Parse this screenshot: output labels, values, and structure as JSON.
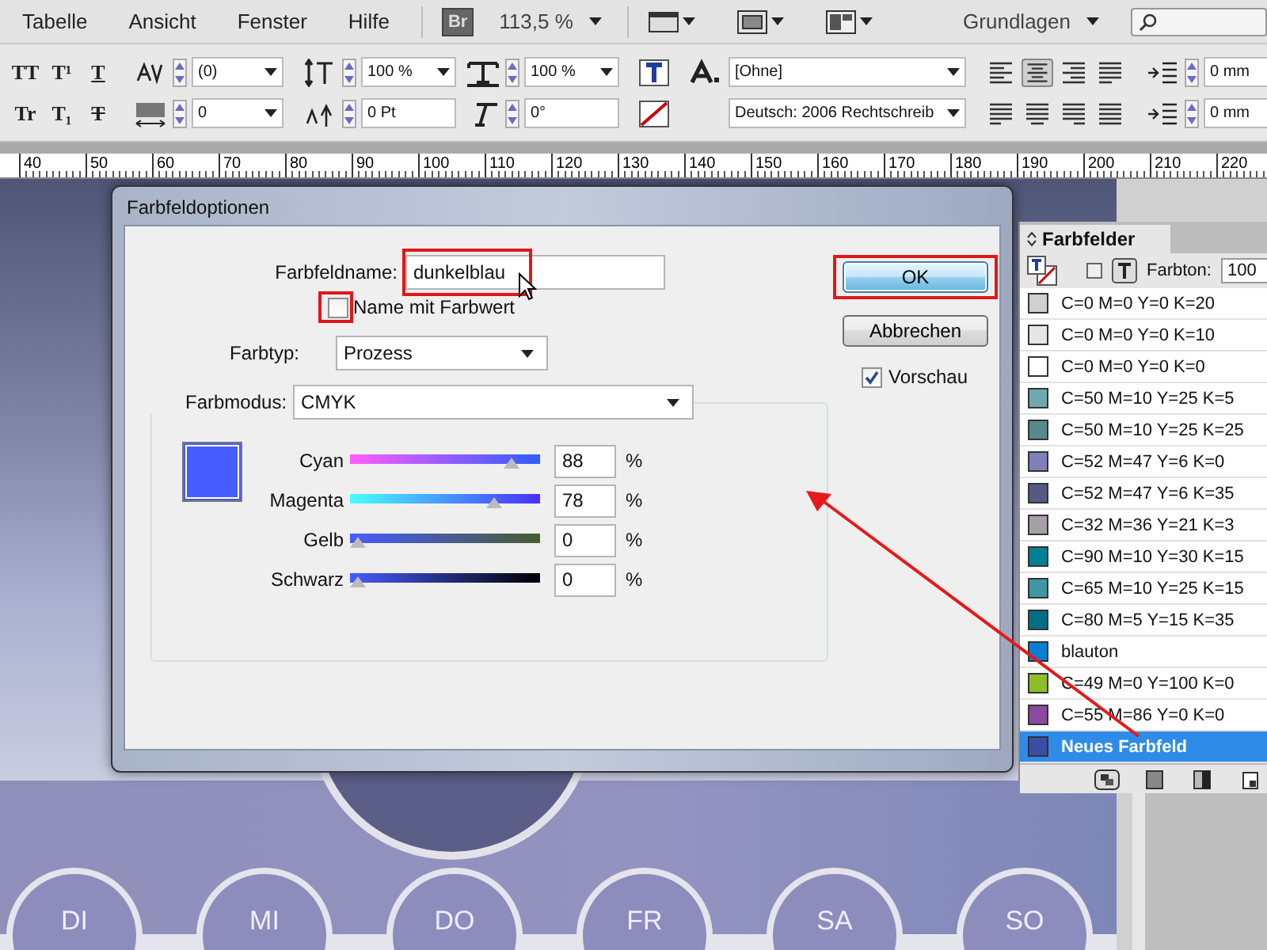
{
  "menu_bar": {
    "items": [
      "Tabelle",
      "Ansicht",
      "Fenster",
      "Hilfe"
    ],
    "bridge_button": "Br",
    "zoom": "113,5 %",
    "workspace": "Grundlagen"
  },
  "control_panel": {
    "text_style_buttons": [
      "TT",
      "T¹",
      "T",
      "Tr",
      "T₁",
      "T"
    ],
    "kerning": "(0)",
    "tracking": "0",
    "vertical_scale": "100 %",
    "baseline_shift": "0 Pt",
    "horizontal_scale": "100 %",
    "skew": "0°",
    "character_style": "[Ohne]",
    "language": "Deutsch: 2006 Rechtschreib",
    "indent_left": "0 mm",
    "indent_first": "0 mm"
  },
  "ruler": {
    "labels": [
      "40",
      "50",
      "60",
      "70",
      "80",
      "90",
      "100",
      "110",
      "120",
      "130",
      "140",
      "150",
      "160",
      "170",
      "180",
      "190",
      "200",
      "210",
      "220"
    ]
  },
  "dialog": {
    "title": "Farbfeldoptionen",
    "name_label": "Farbfeldname:",
    "name_value": "dunkelblau",
    "name_with_value": {
      "label": "Name mit Farbwert",
      "checked": false
    },
    "color_type": {
      "label": "Farbtyp:",
      "value": "Prozess"
    },
    "color_mode": {
      "label": "Farbmodus:",
      "value": "CMYK"
    },
    "sliders": [
      {
        "label": "Cyan",
        "value": "88",
        "unit": "%",
        "level": 0.88
      },
      {
        "label": "Magenta",
        "value": "78",
        "unit": "%",
        "level": 0.78
      },
      {
        "label": "Gelb",
        "value": "0",
        "unit": "%",
        "level": 0
      },
      {
        "label": "Schwarz",
        "value": "0",
        "unit": "%",
        "level": 0
      }
    ],
    "buttons": [
      {
        "label": "OK",
        "default": true
      },
      {
        "label": "Abbrechen",
        "default": false
      }
    ],
    "preview": {
      "label": "Vorschau",
      "checked": true
    }
  },
  "swatches_panel": {
    "title": "Farbfelder",
    "tint_label": "Farbton:",
    "tint_value": "100",
    "swatches": [
      {
        "name": "C=0 M=0 Y=0 K=20",
        "color": "#d0d0d0",
        "selected": false
      },
      {
        "name": "C=0 M=0 Y=0 K=10",
        "color": "#e6e6e6",
        "selected": false
      },
      {
        "name": "C=0 M=0 Y=0 K=0",
        "color": "#ffffff",
        "selected": false
      },
      {
        "name": "C=50 M=10 Y=25 K=5",
        "color": "#6fa9ad",
        "selected": false
      },
      {
        "name": "C=50 M=10 Y=25 K=25",
        "color": "#568a8b",
        "selected": false
      },
      {
        "name": "C=52 M=47 Y=6 K=0",
        "color": "#7f80b8",
        "selected": false
      },
      {
        "name": "C=52 M=47 Y=6 K=35",
        "color": "#575985",
        "selected": false
      },
      {
        "name": "C=32 M=36 Y=21 K=3",
        "color": "#a89ea8",
        "selected": false
      },
      {
        "name": "C=90 M=10 Y=30 K=15",
        "color": "#007f95",
        "selected": false
      },
      {
        "name": "C=65 M=10 Y=25 K=15",
        "color": "#3f97a6",
        "selected": false
      },
      {
        "name": "C=80 M=5 Y=15 K=35",
        "color": "#006f86",
        "selected": false
      },
      {
        "name": "blauton",
        "color": "#0a7fd0",
        "selected": false
      },
      {
        "name": "C=49 M=0 Y=100 K=0",
        "color": "#8fbd2a",
        "selected": false
      },
      {
        "name": "C=55 M=86 Y=0 K=0",
        "color": "#8a4a9f",
        "selected": false
      },
      {
        "name": "Neues Farbfeld",
        "color": "#3a4ea6",
        "selected": true
      }
    ]
  },
  "canvas": {
    "day_labels": [
      "DI",
      "MI",
      "DO",
      "FR",
      "SA",
      "SO"
    ]
  }
}
